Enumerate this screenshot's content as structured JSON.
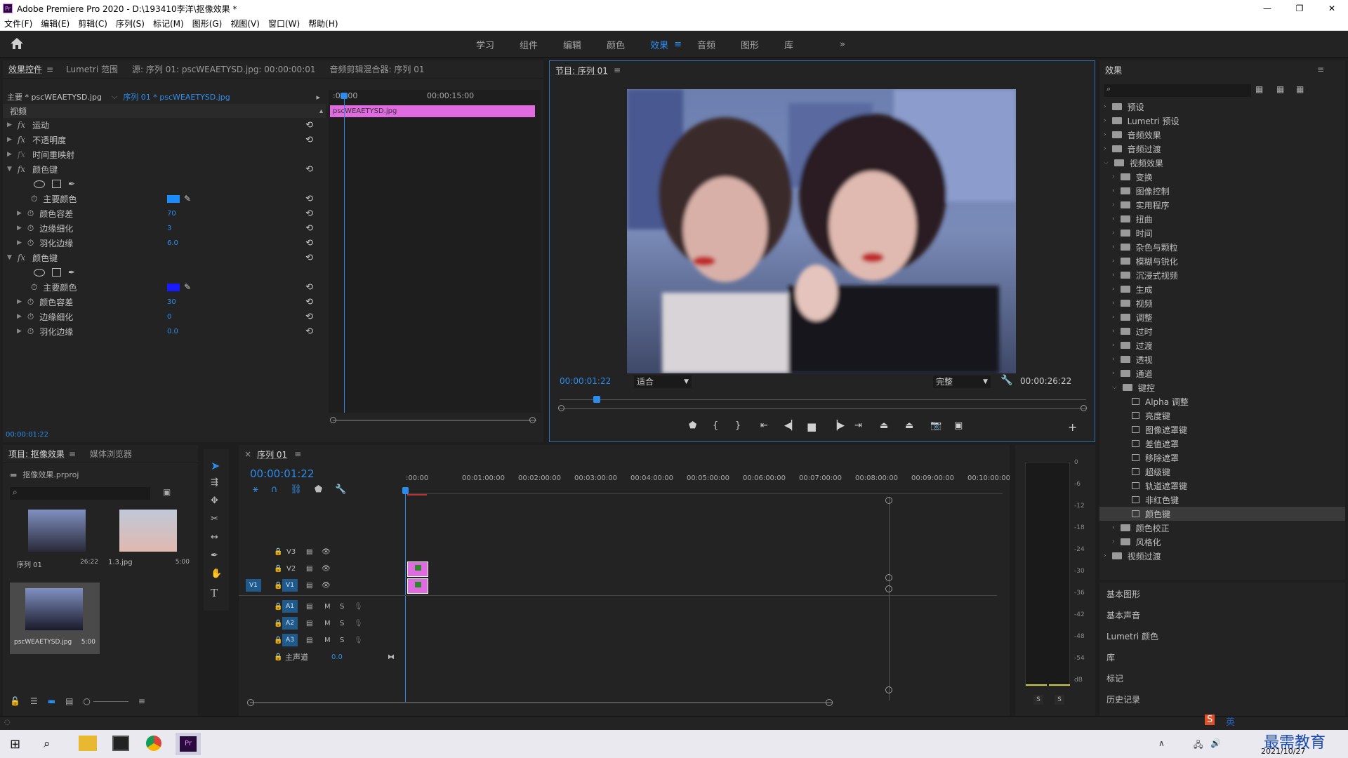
{
  "titlebar": {
    "title": "Adobe Premiere Pro 2020 - D:\\193410李洋\\抠像效果 *",
    "logo": "Pr"
  },
  "window_buttons": {
    "minimize": "—",
    "maximize": "❐",
    "close": "✕"
  },
  "menu": [
    "文件(F)",
    "编辑(E)",
    "剪辑(C)",
    "序列(S)",
    "标记(M)",
    "图形(G)",
    "视图(V)",
    "窗口(W)",
    "帮助(H)"
  ],
  "workspaces": {
    "items": [
      "学习",
      "组件",
      "编辑",
      "颜色",
      "效果",
      "音频",
      "图形",
      "库"
    ],
    "active": "效果",
    "more": "»",
    "menu_glyph": "≡"
  },
  "effect_controls": {
    "tabs": [
      "效果控件",
      "Lumetri 范围",
      "源: 序列 01: pscWEAETYSD.jpg: 00:00:00:01",
      "音频剪辑混合器: 序列 01"
    ],
    "master": "主要 * pscWEAETYSD.jpg",
    "sequence": "序列 01 * pscWEAETYSD.jpg",
    "timecode_start": ":00:00",
    "timecode_mid": "00:00:15:00",
    "clip_name": "pscWEAETYSD.jpg",
    "section_video": "视频",
    "fx_label": "fx",
    "effects": [
      "运动",
      "不透明度",
      "时间重映射",
      "颜色键"
    ],
    "colorkey1": {
      "name": "颜色键",
      "params": [
        {
          "label": "主要颜色",
          "value": ""
        },
        {
          "label": "颜色容差",
          "value": "70"
        },
        {
          "label": "边缘细化",
          "value": "3"
        },
        {
          "label": "羽化边缘",
          "value": "6.0"
        }
      ],
      "swatch": "#1a8cff"
    },
    "colorkey2": {
      "name": "颜色键",
      "params": [
        {
          "label": "主要颜色",
          "value": ""
        },
        {
          "label": "颜色容差",
          "value": "30"
        },
        {
          "label": "边缘细化",
          "value": "0"
        },
        {
          "label": "羽化边缘",
          "value": "0.0"
        }
      ],
      "swatch": "#1a1aff"
    },
    "timecode_bottom": "00:00:01:22"
  },
  "program": {
    "title": "节目: 序列 01",
    "timecode": "00:00:01:22",
    "fit": "适合",
    "quality": "完整",
    "duration": "00:00:26:22"
  },
  "effects_panel": {
    "title": "效果",
    "tree": [
      {
        "label": "预设",
        "level": 0,
        "type": "folder"
      },
      {
        "label": "Lumetri 预设",
        "level": 0,
        "type": "folder"
      },
      {
        "label": "音频效果",
        "level": 0,
        "type": "folder"
      },
      {
        "label": "音频过渡",
        "level": 0,
        "type": "folder"
      },
      {
        "label": "视频效果",
        "level": 0,
        "type": "folder",
        "open": true
      },
      {
        "label": "变换",
        "level": 1,
        "type": "folder"
      },
      {
        "label": "图像控制",
        "level": 1,
        "type": "folder"
      },
      {
        "label": "实用程序",
        "level": 1,
        "type": "folder"
      },
      {
        "label": "扭曲",
        "level": 1,
        "type": "folder"
      },
      {
        "label": "时间",
        "level": 1,
        "type": "folder"
      },
      {
        "label": "杂色与颗粒",
        "level": 1,
        "type": "folder"
      },
      {
        "label": "模糊与锐化",
        "level": 1,
        "type": "folder"
      },
      {
        "label": "沉浸式视频",
        "level": 1,
        "type": "folder"
      },
      {
        "label": "生成",
        "level": 1,
        "type": "folder"
      },
      {
        "label": "视频",
        "level": 1,
        "type": "folder"
      },
      {
        "label": "调整",
        "level": 1,
        "type": "folder"
      },
      {
        "label": "过时",
        "level": 1,
        "type": "folder"
      },
      {
        "label": "过渡",
        "level": 1,
        "type": "folder"
      },
      {
        "label": "透视",
        "level": 1,
        "type": "folder"
      },
      {
        "label": "通道",
        "level": 1,
        "type": "folder"
      },
      {
        "label": "键控",
        "level": 1,
        "type": "folder",
        "open": true
      },
      {
        "label": "Alpha 调整",
        "level": 2,
        "type": "effect"
      },
      {
        "label": "亮度键",
        "level": 2,
        "type": "effect"
      },
      {
        "label": "图像遮罩键",
        "level": 2,
        "type": "effect"
      },
      {
        "label": "差值遮罩",
        "level": 2,
        "type": "effect"
      },
      {
        "label": "移除遮罩",
        "level": 2,
        "type": "effect"
      },
      {
        "label": "超级键",
        "level": 2,
        "type": "effect"
      },
      {
        "label": "轨道遮罩键",
        "level": 2,
        "type": "effect"
      },
      {
        "label": "非红色键",
        "level": 2,
        "type": "effect"
      },
      {
        "label": "颜色键",
        "level": 2,
        "type": "effect",
        "selected": true
      },
      {
        "label": "颜色校正",
        "level": 1,
        "type": "folder"
      },
      {
        "label": "风格化",
        "level": 1,
        "type": "folder"
      },
      {
        "label": "视频过渡",
        "level": 0,
        "type": "folder"
      }
    ],
    "side_panels": [
      "基本图形",
      "基本声音",
      "Lumetri 颜色",
      "库",
      "标记",
      "历史记录"
    ]
  },
  "project": {
    "tabs": [
      "项目: 抠像效果",
      "媒体浏览器"
    ],
    "file": "抠像效果.prproj",
    "items": [
      {
        "name": "序列 01",
        "duration": "26:22"
      },
      {
        "name": "1.3.jpg",
        "duration": "5:00"
      },
      {
        "name": "pscWEAETYSD.jpg",
        "duration": "5:00"
      }
    ]
  },
  "timeline": {
    "title": "序列 01",
    "timecode": "00:00:01:22",
    "ruler": [
      ":00:00",
      "00:01:00:00",
      "00:02:00:00",
      "00:03:00:00",
      "00:04:00:00",
      "00:05:00:00",
      "00:06:00:00",
      "00:07:00:00",
      "00:08:00:00",
      "00:09:00:00",
      "00:10:00:00"
    ],
    "video_tracks": [
      "V3",
      "V2",
      "V1"
    ],
    "audio_tracks": [
      "A1",
      "A2",
      "A3"
    ],
    "source_patch": "V1",
    "master_label": "主声道",
    "master_value": "0.0",
    "m": "M",
    "s": "S"
  },
  "meter": {
    "labels": [
      "0",
      "-6",
      "-12",
      "-18",
      "-24",
      "-30",
      "-36",
      "-42",
      "-48",
      "-54",
      "dB"
    ],
    "solo": "S"
  },
  "taskbar": {
    "date": "2021/10/27",
    "ime": "英",
    "watermark": "最需教育"
  }
}
